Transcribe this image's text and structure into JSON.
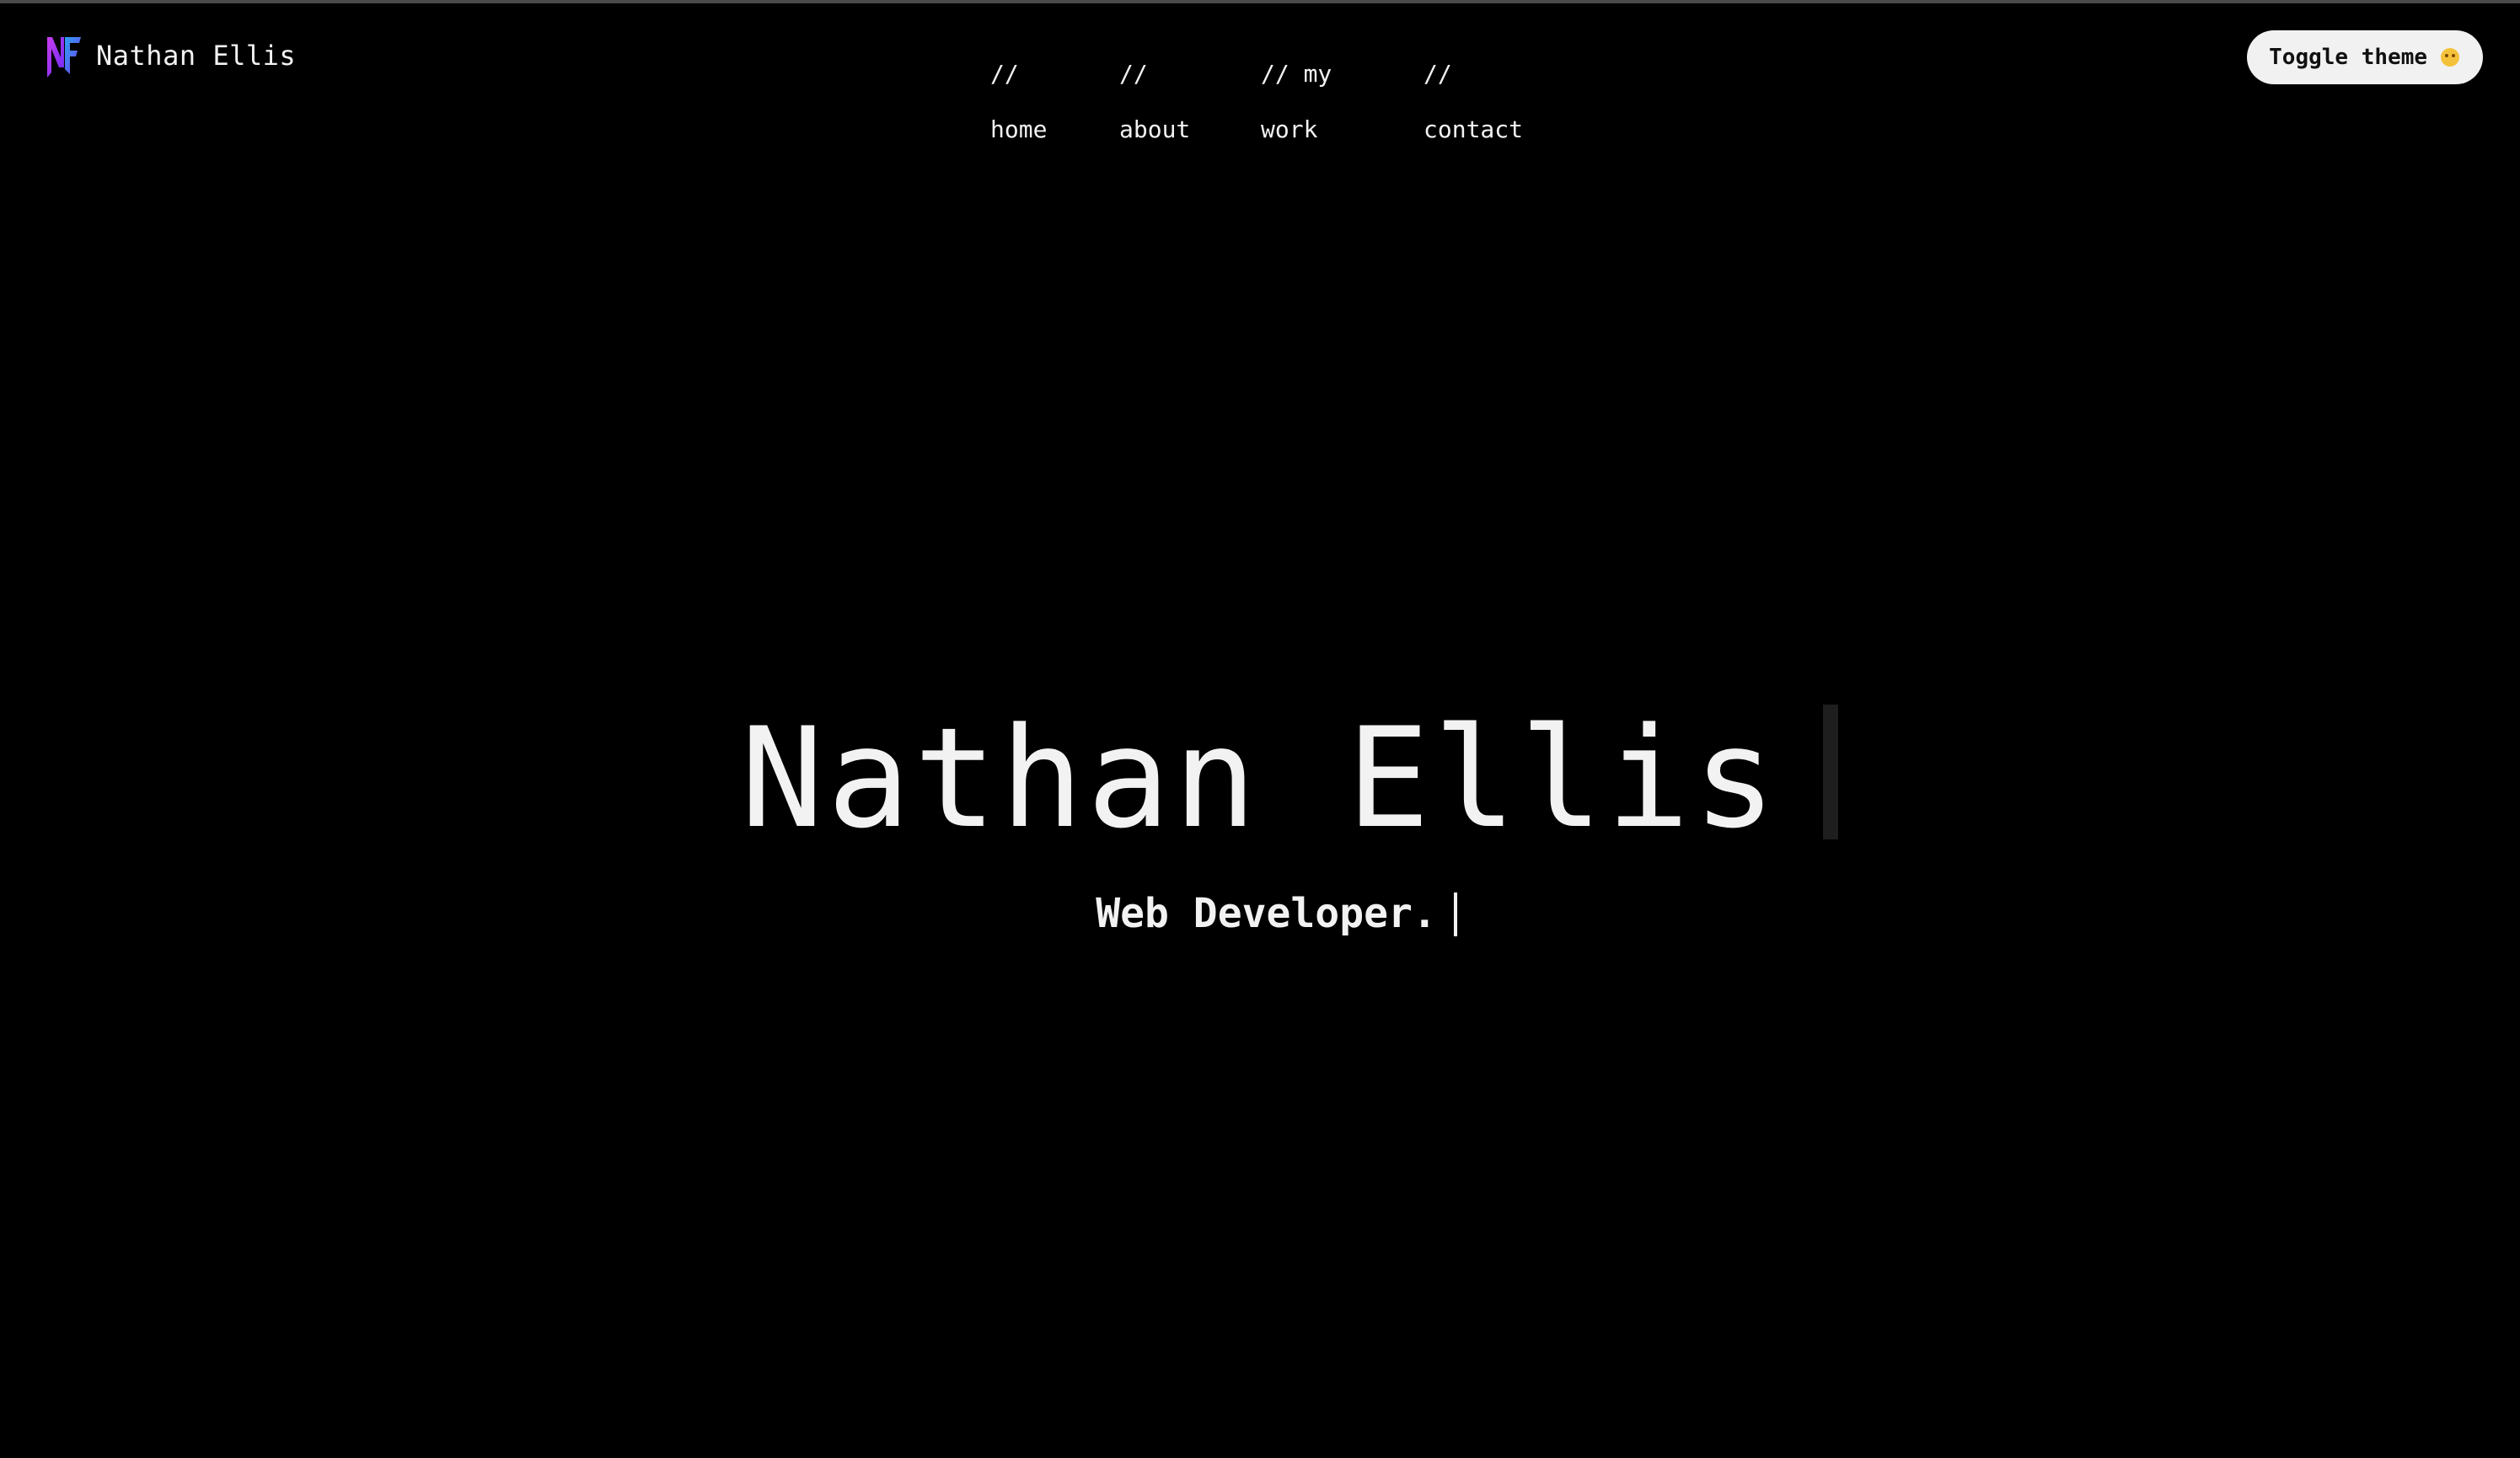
{
  "brand": {
    "name": "Nathan Ellis",
    "logo_icon": "nf-monogram-icon",
    "logo_colors": [
      "#6a2cf5",
      "#c93cf0",
      "#2aa0f5"
    ]
  },
  "nav": {
    "items": [
      {
        "prefix": "//",
        "label": "home"
      },
      {
        "prefix": "//",
        "label": "about"
      },
      {
        "prefix": "// my",
        "label": "work"
      },
      {
        "prefix": "//",
        "label": "contact"
      }
    ]
  },
  "toggle": {
    "label": "Toggle theme",
    "icon": "smiley-emoji-icon"
  },
  "hero": {
    "title": "Nathan Ellis",
    "subtitle": "Web Developer."
  },
  "colors": {
    "background": "#000000",
    "text": "#f2f2f2",
    "button_bg": "#f1f1f1"
  }
}
